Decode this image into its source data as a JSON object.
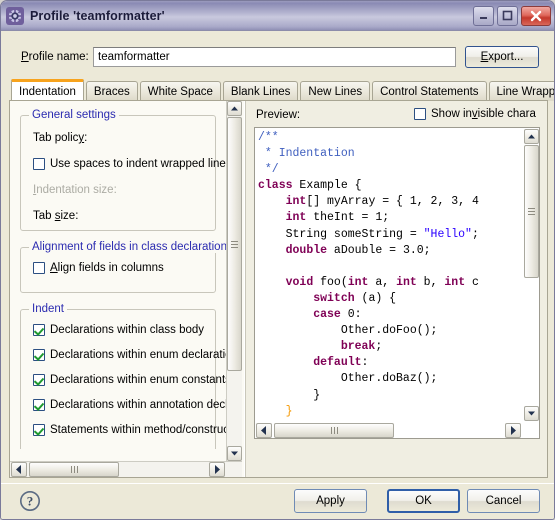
{
  "window": {
    "title": "Profile 'teamformatter'",
    "icon": "gear-icon",
    "minimize_label": "–",
    "maximize_label": "□",
    "close_label": "✕"
  },
  "profile": {
    "label": "Profile name:",
    "value": "teamformatter",
    "placeholder": "",
    "export_label": "Export..."
  },
  "tabs": [
    {
      "label": "Indentation",
      "active": true
    },
    {
      "label": "Braces",
      "active": false
    },
    {
      "label": "White Space",
      "active": false
    },
    {
      "label": "Blank Lines",
      "active": false
    },
    {
      "label": "New Lines",
      "active": false
    },
    {
      "label": "Control Statements",
      "active": false
    },
    {
      "label": "Line Wrapping",
      "active": false
    }
  ],
  "tab_scroll": {
    "prev": "◄",
    "next": "►"
  },
  "settings": {
    "general": {
      "title": "General settings",
      "tab_policy_label": "Tab policy:",
      "use_spaces_label": "Use spaces to indent wrapped lines",
      "use_spaces_checked": false,
      "indentation_size_label": "Indentation size:",
      "indentation_size_disabled": true,
      "tab_size_label": "Tab size:"
    },
    "alignment": {
      "title": "Alignment of fields in class declarations",
      "align_fields_label": "Align fields in columns",
      "align_fields_checked": false
    },
    "indent": {
      "title": "Indent",
      "items": [
        {
          "label": "Declarations within class body",
          "checked": true
        },
        {
          "label": "Declarations within enum declaration",
          "checked": true
        },
        {
          "label": "Declarations within enum constants",
          "checked": true
        },
        {
          "label": "Declarations within annotation declar",
          "checked": true
        },
        {
          "label": "Statements within method/constructo",
          "checked": true
        }
      ]
    }
  },
  "preview": {
    "label": "Preview:",
    "show_invisible_label": "Show invisible chara",
    "show_invisible_checked": false
  },
  "footer": {
    "help_label": "?",
    "apply_label": "Apply",
    "ok_label": "OK",
    "cancel_label": "Cancel"
  },
  "code": {
    "lines": [
      [
        {
          "t": "/**",
          "c": "cm"
        }
      ],
      [
        {
          "t": " * Indentation",
          "c": "cm"
        }
      ],
      [
        {
          "t": " */",
          "c": "cm"
        }
      ],
      [
        {
          "t": "class",
          "c": "k"
        },
        {
          "t": " Example {",
          "c": ""
        }
      ],
      [
        {
          "t": "    ",
          "c": ""
        },
        {
          "t": "int",
          "c": "k"
        },
        {
          "t": "[] myArray = { 1, 2, 3, 4",
          "c": ""
        }
      ],
      [
        {
          "t": "    ",
          "c": ""
        },
        {
          "t": "int",
          "c": "k"
        },
        {
          "t": " theInt = 1;",
          "c": ""
        }
      ],
      [
        {
          "t": "    String someString = ",
          "c": ""
        },
        {
          "t": "\"Hello\"",
          "c": "st"
        },
        {
          "t": ";",
          "c": ""
        }
      ],
      [
        {
          "t": "    ",
          "c": ""
        },
        {
          "t": "double",
          "c": "k"
        },
        {
          "t": " aDouble = 3.0;",
          "c": ""
        }
      ],
      [
        {
          "t": "",
          "c": ""
        }
      ],
      [
        {
          "t": "    ",
          "c": ""
        },
        {
          "t": "void",
          "c": "k"
        },
        {
          "t": " foo(",
          "c": ""
        },
        {
          "t": "int",
          "c": "k"
        },
        {
          "t": " a, ",
          "c": ""
        },
        {
          "t": "int",
          "c": "k"
        },
        {
          "t": " b, ",
          "c": ""
        },
        {
          "t": "int",
          "c": "k"
        },
        {
          "t": " c",
          "c": ""
        }
      ],
      [
        {
          "t": "        ",
          "c": ""
        },
        {
          "t": "switch",
          "c": "k"
        },
        {
          "t": " (a) {",
          "c": ""
        }
      ],
      [
        {
          "t": "        ",
          "c": ""
        },
        {
          "t": "case",
          "c": "k"
        },
        {
          "t": " 0:",
          "c": ""
        }
      ],
      [
        {
          "t": "            Other.doFoo();",
          "c": ""
        }
      ],
      [
        {
          "t": "            ",
          "c": ""
        },
        {
          "t": "break",
          "c": "k"
        },
        {
          "t": ";",
          "c": ""
        }
      ],
      [
        {
          "t": "        ",
          "c": ""
        },
        {
          "t": "default",
          "c": "k"
        },
        {
          "t": ":",
          "c": ""
        }
      ],
      [
        {
          "t": "            Other.doBaz();",
          "c": ""
        }
      ],
      [
        {
          "t": "        }",
          "c": ""
        }
      ],
      [
        {
          "t": "    }",
          "c": "br"
        }
      ]
    ]
  },
  "scrollbars": {
    "up_arrow": "▲",
    "down_arrow": "▼",
    "left_arrow": "◄",
    "right_arrow": "►",
    "grip": "‖"
  }
}
